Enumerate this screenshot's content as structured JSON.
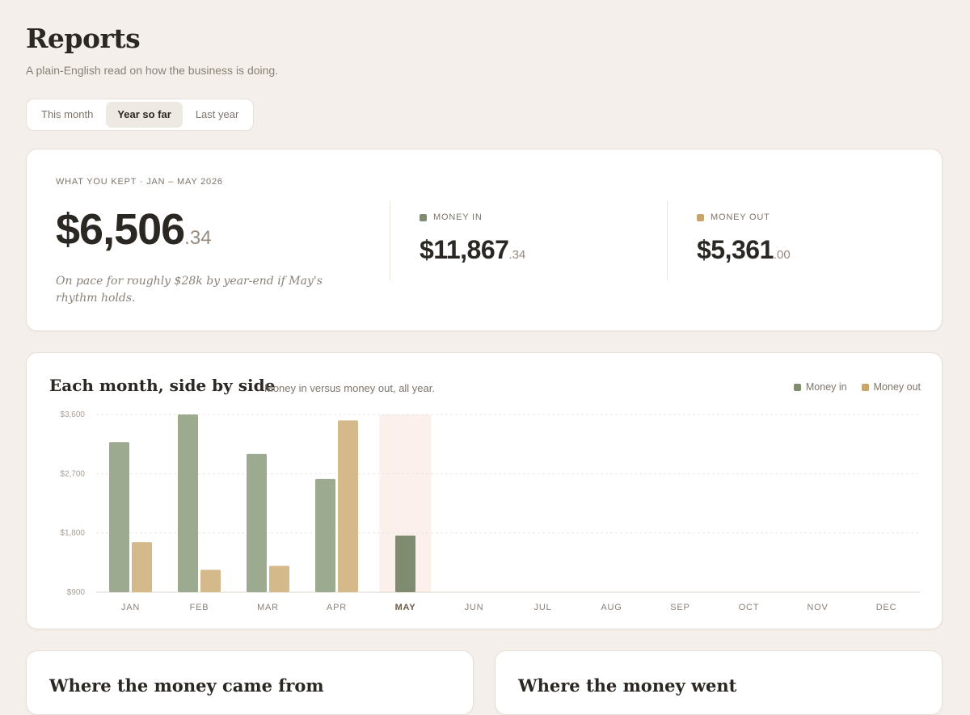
{
  "page": {
    "title": "Reports",
    "subtitle": "A plain-English read on how the business is doing."
  },
  "period_tabs": {
    "items": [
      "This month",
      "Year so far",
      "Last year"
    ],
    "active": "Year so far"
  },
  "summary": {
    "kept_label": "WHAT YOU KEPT · JAN – MAY 2026",
    "kept_whole": "$6,506",
    "kept_cents": ".34",
    "kept_note": "On pace for roughly $28k by year-end if May's rhythm holds.",
    "money_in_label": "MONEY IN",
    "money_in_whole": "$11,867",
    "money_in_cents": ".34",
    "money_out_label": "MONEY OUT",
    "money_out_whole": "$5,361",
    "money_out_cents": ".00"
  },
  "colors": {
    "money_in": "#9caa8f",
    "money_in_current": "#7f8c6f",
    "money_out": "#d4ba8b",
    "money_in_swatch": "#7f8c6f",
    "money_out_swatch": "#c9a56b",
    "current_month_highlight": "#fbf0ec"
  },
  "chart_card": {
    "title": "Each month, side by side",
    "subtitle": "Money in versus money out, all year.",
    "legend": [
      "Money in",
      "Money out"
    ]
  },
  "chart_data": {
    "type": "bar",
    "categories": [
      "JAN",
      "FEB",
      "MAR",
      "APR",
      "MAY",
      "JUN",
      "JUL",
      "AUG",
      "SEP",
      "OCT",
      "NOV",
      "DEC"
    ],
    "series": [
      {
        "name": "Money in",
        "values": [
          3180,
          3600,
          3000,
          2620,
          1760,
          null,
          null,
          null,
          null,
          null,
          null,
          null
        ]
      },
      {
        "name": "Money out",
        "values": [
          1660,
          1240,
          1300,
          3510,
          null,
          null,
          null,
          null,
          null,
          null,
          null,
          null
        ]
      }
    ],
    "yticks": [
      "$900",
      "$1,800",
      "$2,700",
      "$3,600"
    ],
    "ylim": [
      900,
      3600
    ],
    "highlight": "MAY",
    "grid": true,
    "legend_position": "top-right"
  },
  "bottom_cards": {
    "from_title": "Where the money came from",
    "went_title": "Where the money went"
  }
}
